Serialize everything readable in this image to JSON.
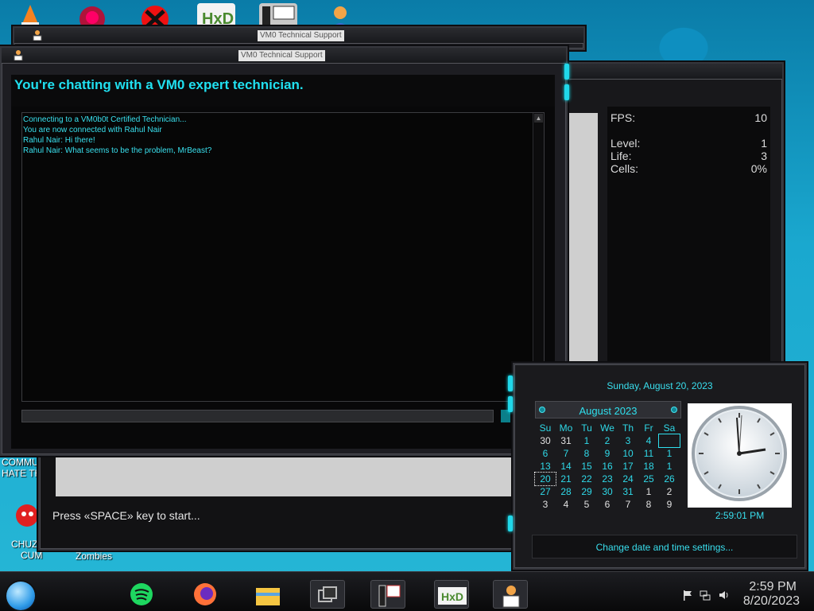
{
  "desktop": {
    "labels": {
      "commu": "COMMU",
      "hate": "HATE TH",
      "chuz": "CHUZ",
      "cum": "CUM",
      "zombies": "Zombies"
    }
  },
  "chat_window": {
    "title": "VM0 Technical Support",
    "back_title": "VM0 Technical Support",
    "heading": "You're chatting with a VM0 expert technician.",
    "messages": [
      "Connecting to a VM0b0t Certified Technician...",
      "You are now connected with Rahul Nair",
      "Rahul Nair: Hi there!",
      "Rahul Nair: What seems to be the problem, MrBeast?"
    ],
    "input_value": ""
  },
  "game_window": {
    "fps_label": "FPS:",
    "fps_value": "10",
    "level_label": "Level:",
    "level_value": "1",
    "life_label": "Life:",
    "life_value": "3",
    "cells_label": "Cells:",
    "cells_value": "0%"
  },
  "lower_window": {
    "prompt": "Press «SPACE» key to start..."
  },
  "calendar_flyout": {
    "date_text": "Sunday, August 20, 2023",
    "month_label": "August 2023",
    "weekdays": [
      "Su",
      "Mo",
      "Tu",
      "We",
      "Th",
      "Fr",
      "Sa"
    ],
    "days": [
      [
        "30",
        "31",
        "1",
        "2",
        "3",
        "4",
        ""
      ],
      [
        "6",
        "7",
        "8",
        "9",
        "10",
        "11",
        "1"
      ],
      [
        "13",
        "14",
        "15",
        "16",
        "17",
        "18",
        "1"
      ],
      [
        "20",
        "21",
        "22",
        "23",
        "24",
        "25",
        "26"
      ],
      [
        "27",
        "28",
        "29",
        "30",
        "31",
        "1",
        "2"
      ],
      [
        "3",
        "4",
        "5",
        "6",
        "7",
        "8",
        "9"
      ]
    ],
    "clock_time": "2:59:01 PM",
    "settings_link": "Change date and time settings..."
  },
  "taskbar": {
    "time": "2:59 PM",
    "date": "8/20/2023"
  },
  "colors": {
    "accent": "#20e0f0",
    "window_bg": "#1d1d22"
  }
}
